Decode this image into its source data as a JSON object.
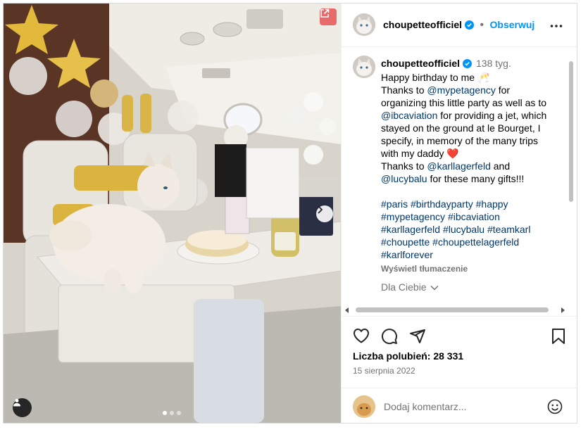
{
  "post": {
    "username": "choupetteofficiel",
    "follow_label": "Obserwuj",
    "age": "138 tyg.",
    "caption_lines": [
      "Happy birthday to me 🥂"
    ],
    "caption_thanks_1a": "Thanks to ",
    "caption_mention_1": "@mypetagency",
    "caption_thanks_1b": " for organizing this little party as well as to ",
    "caption_mention_2": "@ibcaviation",
    "caption_thanks_1c": " for providing a jet, which stayed on the ground at le Bourget, I specify, in memory of the many trips with my daddy ",
    "heart_emoji": "❤️",
    "caption_thanks_2a": "Thanks to ",
    "caption_mention_3": "@karllagerfeld",
    "caption_thanks_2b": " and ",
    "caption_mention_4": "@lucybalu",
    "caption_thanks_2c": " for these many gifts!!!",
    "hashtags": "#paris #birthdayparty #happy #mypetagency #ibcaviation #karllagerfeld #lucybalu #teamkarl #choupette #choupettelagerfeld #karlforever",
    "translate_label": "Wyświetl tłumaczenie",
    "for_you_label": "Dla Ciebie",
    "likes_label": "Liczba polubień: 28 331",
    "date_label": "15 sierpnia 2022",
    "comment_placeholder": "Dodaj komentarz..."
  },
  "icons": {
    "verified": "verified-badge-icon",
    "more": "more-options-icon",
    "like": "heart-icon",
    "comment": "comment-icon",
    "share": "share-icon",
    "save": "bookmark-icon",
    "emoji": "emoji-icon",
    "open": "open-external-icon",
    "next": "chevron-right-icon",
    "tag": "user-tag-icon"
  },
  "colors": {
    "accent": "#0095f6",
    "link": "#00376b",
    "muted": "#737373"
  }
}
